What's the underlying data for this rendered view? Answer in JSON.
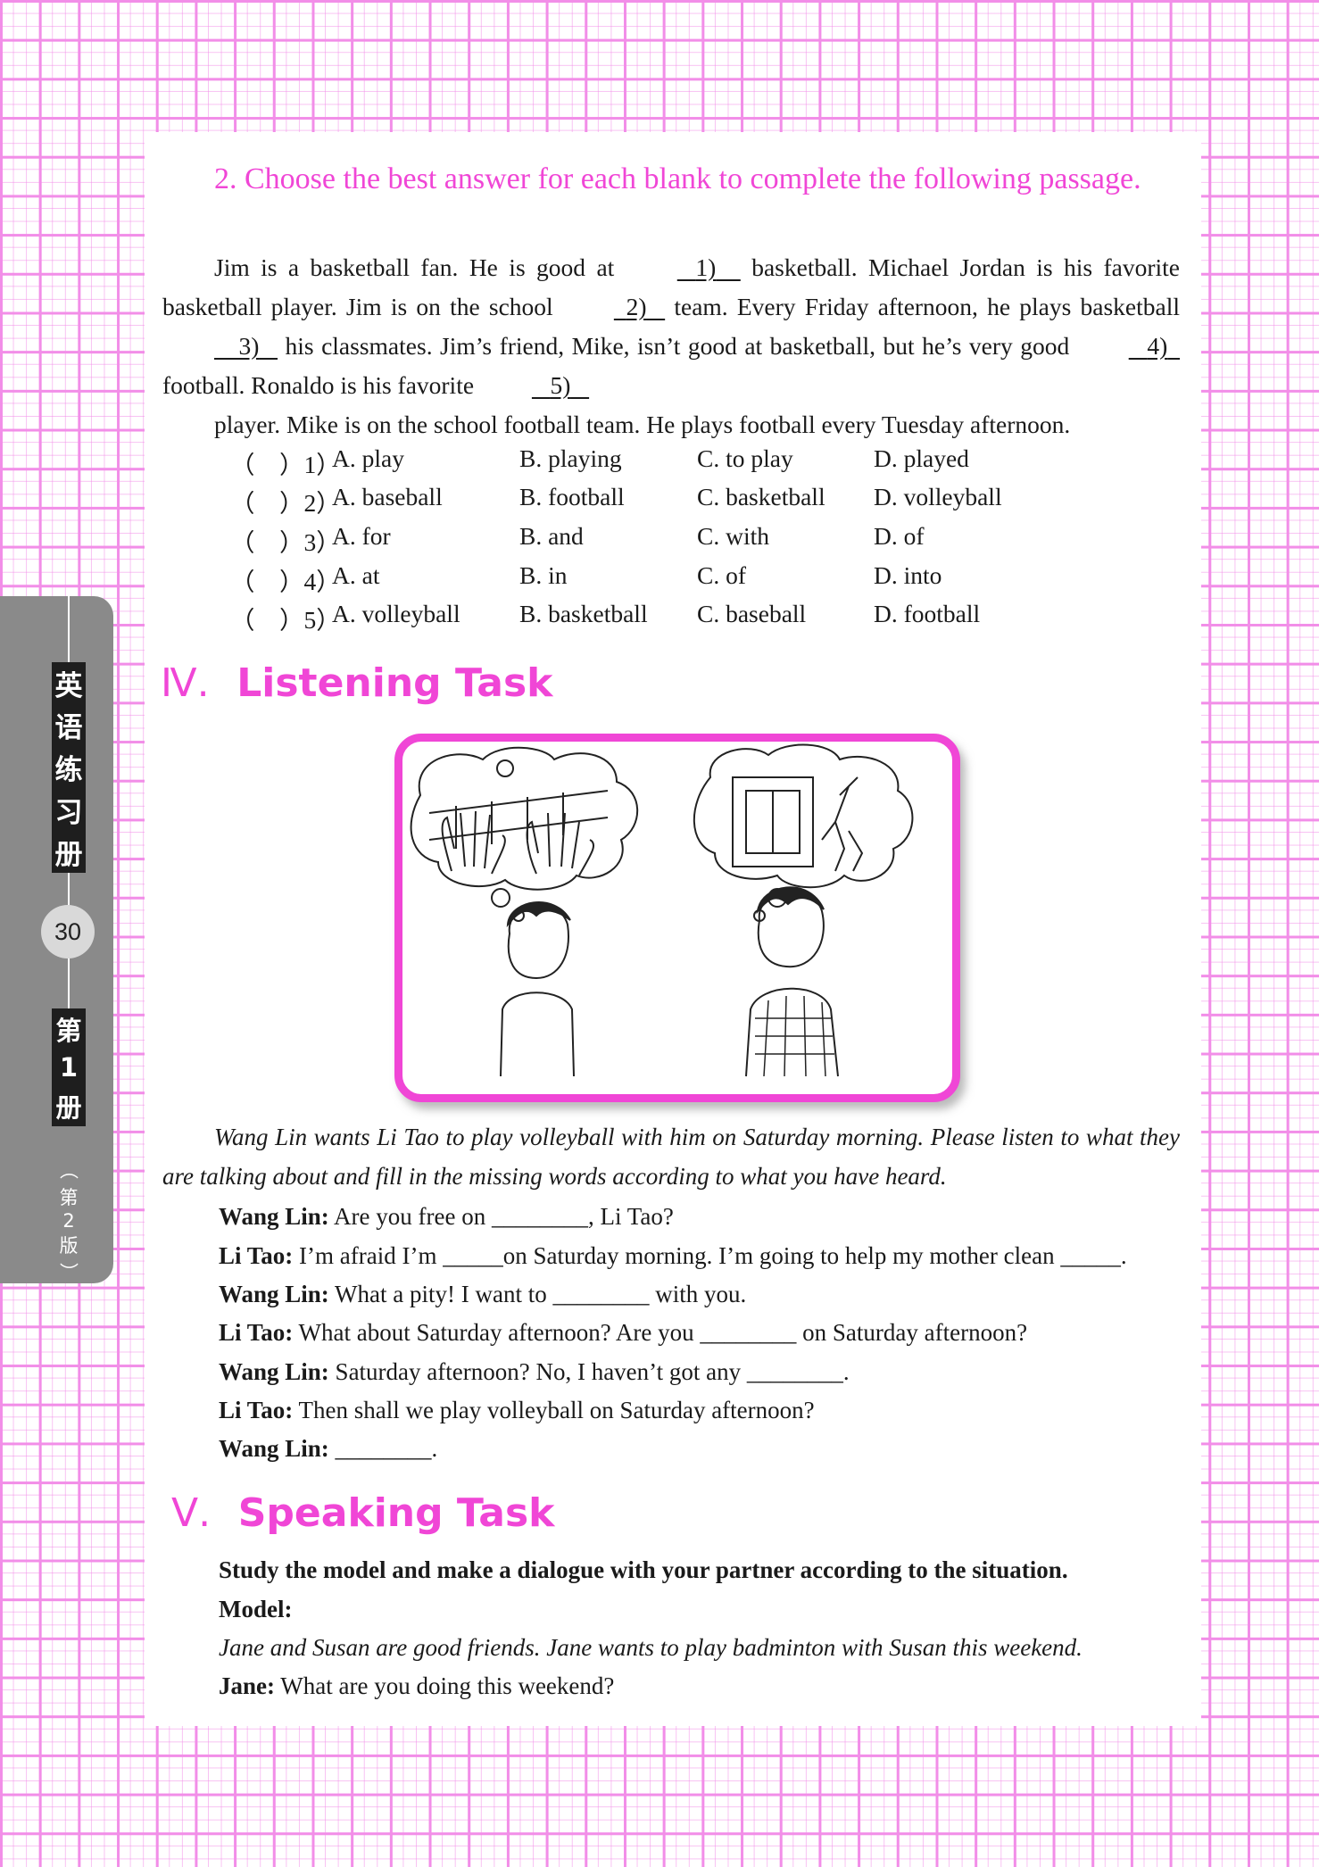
{
  "exercise2": {
    "heading": "2. Choose the best answer for each blank to complete the following passage.",
    "p_jim_a": "Jim is a basketball fan. He is good at ",
    "b1": "1)",
    "p_jim_b": " basketball. Michael Jordan is his favorite basketball player. Jim is on the school ",
    "b2": "2)",
    "p_jim_c": " team. Every Friday afternoon, he plays basketball ",
    "b3": "3)",
    "p_jim_d": " his classmates. Jim’s friend, Mike, isn’t good at basketball, but he’s very good ",
    "b4": "4)",
    "p_jim_e": " football. Ronaldo is his favorite ",
    "b5": "5)",
    "p_jim_f": "player. Mike is on the school football team. He plays football every Tuesday afternoon.",
    "questions": [
      {
        "num": "（　）1）",
        "a": "A. play",
        "b": "B. playing",
        "c": "C. to play",
        "d": "D. played"
      },
      {
        "num": "（　）2）",
        "a": "A. baseball",
        "b": "B. football",
        "c": "C. basketball",
        "d": "D. volleyball"
      },
      {
        "num": "（　）3）",
        "a": "A. for",
        "b": "B. and",
        "c": "C. with",
        "d": "D. of"
      },
      {
        "num": "（　）4）",
        "a": "A. at",
        "b": "B. in",
        "c": "C. of",
        "d": "D. into"
      },
      {
        "num": "（　）5）",
        "a": "A. volleyball",
        "b": "B. basketball",
        "c": "C. baseball",
        "d": "D. football"
      }
    ]
  },
  "listening": {
    "numeral": "Ⅳ.",
    "title": "Listening Task",
    "intro": "Wang Lin wants Li Tao to play volleyball with him on Saturday morning. Please listen to what they are talking about and fill in the missing words according to what you have heard.",
    "lines": [
      {
        "speaker": "Wang Lin:",
        "text": " Are you free on ________, Li Tao?"
      },
      {
        "speaker": "Li Tao:",
        "text": " I’m afraid I’m _____on Saturday morning. I’m going to help my mother clean _____."
      },
      {
        "speaker": "Wang Lin:",
        "text": " What a pity! I want to ________ with you."
      },
      {
        "speaker": "Li Tao:",
        "text": " What about Saturday afternoon? Are you ________ on Saturday afternoon?"
      },
      {
        "speaker": "Wang Lin:",
        "text": " Saturday afternoon? No, I haven’t got any ________."
      },
      {
        "speaker": "Li Tao:",
        "text": " Then shall we play volleyball on Saturday afternoon?"
      },
      {
        "speaker": "Wang Lin:",
        "text": " ________."
      }
    ]
  },
  "speaking": {
    "numeral": "Ⅴ.",
    "title": "Speaking Task",
    "instruction": "Study the model and make a dialogue with your partner according to the situation.",
    "model_label": "Model:",
    "situation": "Jane and Susan are good friends. Jane wants to play badminton with Susan this weekend.",
    "jane_speaker": "Jane:",
    "jane_line": " What are you doing this weekend?"
  },
  "sidebar": {
    "book_title_chars": [
      "英",
      "语",
      "练",
      "习",
      "册"
    ],
    "page_number": "30",
    "volume_chars": [
      "第",
      "1",
      "册"
    ],
    "edition_chars": [
      "（",
      "第",
      "2",
      "版",
      "）"
    ]
  },
  "colors": {
    "accent": "#f046d6",
    "grid": "#f28ee8",
    "sidebar": "#8a8a8a"
  }
}
